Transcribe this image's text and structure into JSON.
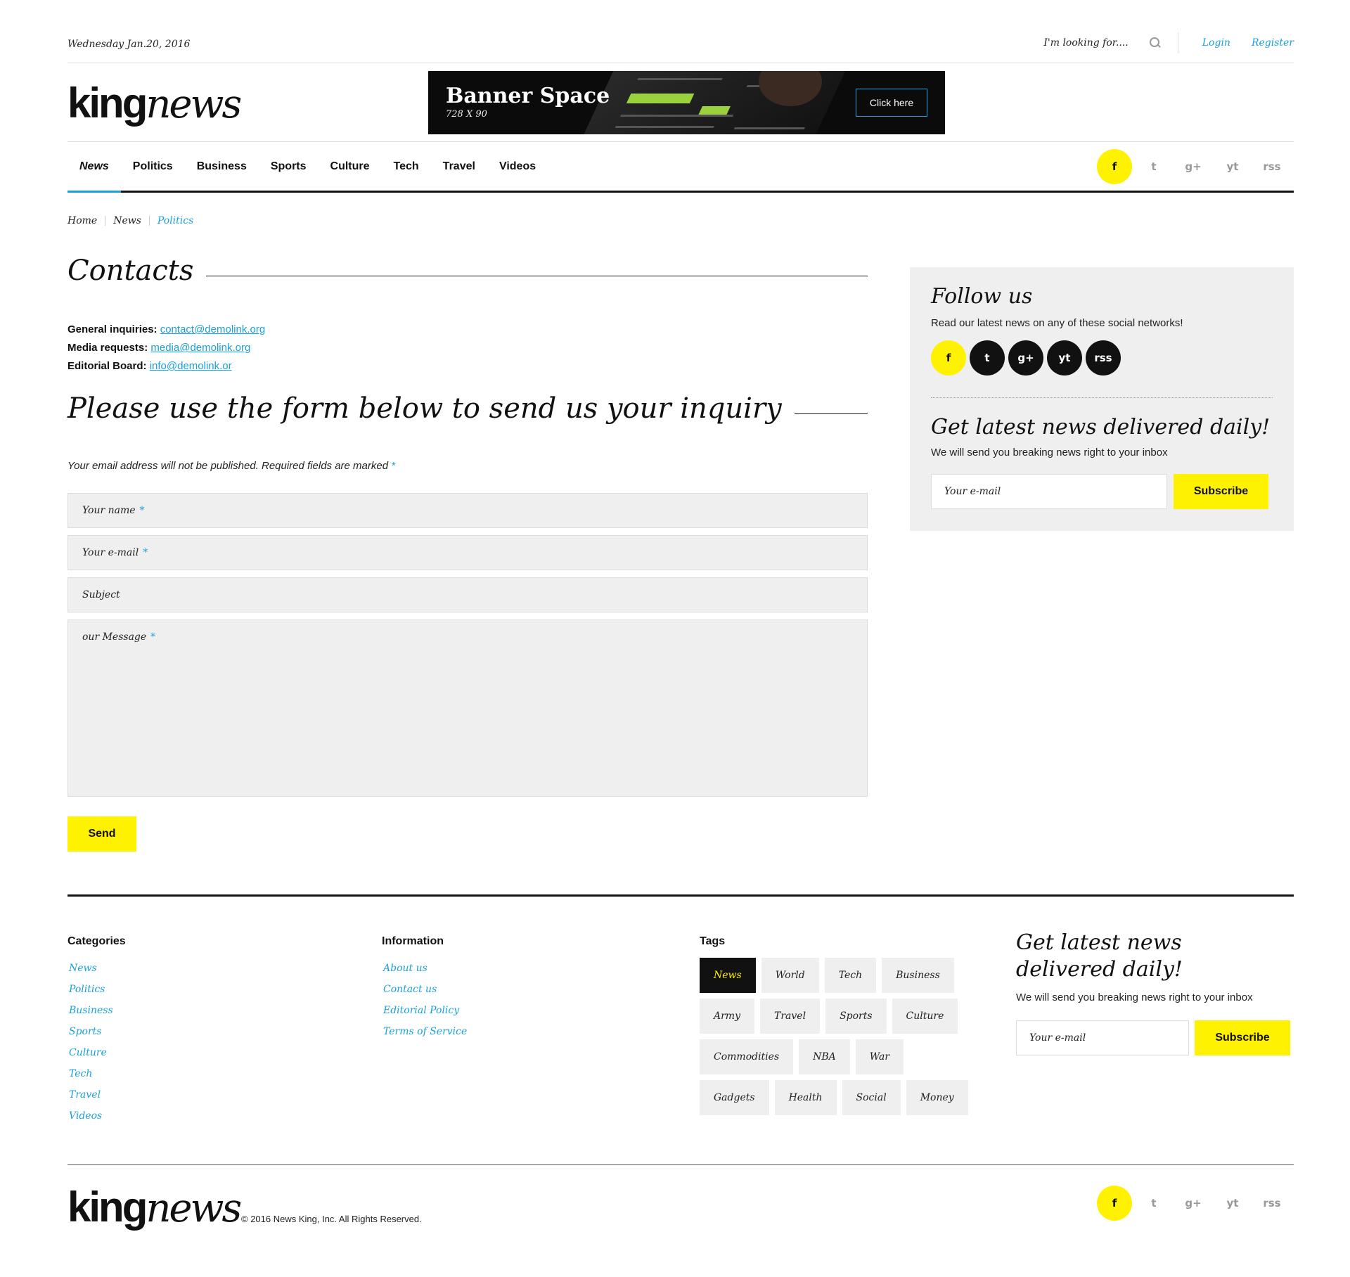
{
  "topbar": {
    "date": "Wednesday Jan.20, 2016",
    "search_placeholder": "I'm looking for....",
    "login": "Login",
    "register": "Register"
  },
  "logo": {
    "king": "king",
    "news": "news"
  },
  "banner": {
    "title": "Banner Space",
    "size": "728 X 90",
    "button": "Click here"
  },
  "nav": {
    "items": [
      "News",
      "Politics",
      "Business",
      "Sports",
      "Culture",
      "Tech",
      "Travel",
      "Videos"
    ],
    "active_index": 0
  },
  "social": {
    "icons": [
      "facebook-icon",
      "twitter-icon",
      "google-plus-icon",
      "youtube-icon",
      "rss-icon"
    ],
    "glyphs": [
      "f",
      "t",
      "g+",
      "yt",
      "rss"
    ]
  },
  "breadcrumb": {
    "home": "Home",
    "news": "News",
    "current": "Politics"
  },
  "contacts": {
    "title": "Contacts",
    "general_label": "General inquiries:",
    "general_email": "contact@demolink.org",
    "media_label": "Media requests:",
    "media_email": "media@demolink.org",
    "editorial_label": "Editorial Board:",
    "editorial_email": "info@demolink.or"
  },
  "form": {
    "title": "Please use the form below to send us your inquiry",
    "note": "Your email address will not be published. Required fields are marked",
    "required_mark": "*",
    "name_placeholder": "Your name",
    "email_placeholder": "Your e-mail",
    "subject_placeholder": "Subject",
    "message_placeholder": "our Message",
    "send": "Send"
  },
  "sidebar": {
    "follow_title": "Follow us",
    "follow_text": "Read our latest news on any of these social networks!",
    "news_title": "Get latest news delivered daily!",
    "news_text": "We will send you breaking news right to your inbox",
    "email_placeholder": "Your e-mail",
    "subscribe": "Subscribe"
  },
  "footer": {
    "categories_title": "Categories",
    "categories": [
      "News",
      "Politics",
      "Business",
      "Sports",
      "Culture",
      "Tech",
      "Travel",
      "Videos"
    ],
    "information_title": "Information",
    "information": [
      "About us",
      "Contact us",
      "Editorial Policy",
      "Terms of Service"
    ],
    "tags_title": "Tags",
    "tags": [
      "News",
      "World",
      "Tech",
      "Business",
      "Army",
      "Travel",
      "Sports",
      "Culture",
      "Commodities",
      "NBA",
      "War",
      "Gadgets",
      "Health",
      "Social",
      "Money"
    ],
    "news_title": "Get latest news delivered daily!",
    "news_text": "We will send you breaking news right to your inbox",
    "email_placeholder": "Your e-mail",
    "subscribe": "Subscribe",
    "copyright": "© 2016 News King, Inc. All Rights Reserved."
  },
  "colors": {
    "accent": "#1aa0dc",
    "highlight": "#fff200",
    "dark": "#111111",
    "field": "#efefef"
  }
}
